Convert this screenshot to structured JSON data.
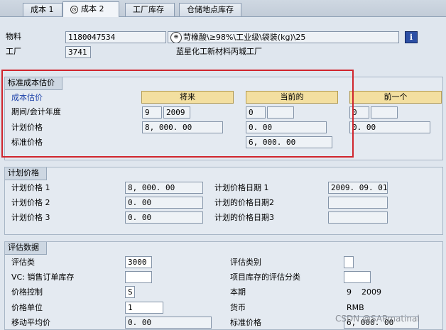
{
  "tabs": [
    {
      "label": "成本 1"
    },
    {
      "label": "成本 2",
      "icon": "display-icon"
    },
    {
      "label": "工厂库存"
    },
    {
      "label": "仓储地点库存"
    }
  ],
  "header": {
    "material_label": "物料",
    "material_value": "1180047534",
    "material_desc": "苛橡酸\\≥98%\\工业级\\袋装(kg)\\25",
    "material_icon_glyph": "⊕",
    "plant_label": "工厂",
    "plant_value": "3741",
    "plant_desc": "蓝星化工新材料丙城工厂",
    "info_glyph": "i"
  },
  "std_cost": {
    "title": "标准成本估价",
    "sub_label": "成本估价",
    "col_future": "将来",
    "col_current": "当前的",
    "col_previous": "前一个",
    "row_period_label": "期间/会计年度",
    "row_plan_label": "计划价格",
    "row_std_label": "标准价格",
    "future_period": "9",
    "future_year": "2009",
    "future_plan": "8, 000. 00",
    "current_period": "0",
    "current_year": "",
    "current_plan": "0. 00",
    "current_std": "6, 000. 00",
    "prev_period": "0",
    "prev_year": "",
    "prev_plan": "0. 00"
  },
  "planned": {
    "title": "计划价格",
    "p1_label": "计划价格 1",
    "p1_value": "8, 000. 00",
    "p2_label": "计划价格 2",
    "p2_value": "0. 00",
    "p3_label": "计划价格 3",
    "p3_value": "0. 00",
    "d1_label": "计划价格日期 1",
    "d1_value": "2009. 09. 01",
    "d2_label": "计划的价格日期2",
    "d2_value": "",
    "d3_label": "计划的价格日期3",
    "d3_value": ""
  },
  "valuation": {
    "title": "评估数据",
    "class_label": "评估类",
    "class_value": "3000",
    "vc_label": "VC: 销售订单库存",
    "vc_value": "",
    "price_ctrl_label": "价格控制",
    "price_ctrl_value": "S",
    "price_unit_label": "价格单位",
    "price_unit_value": "1",
    "mov_avg_label": "移动平均价",
    "mov_avg_value": "0. 00",
    "cat_label": "评估类别",
    "cat_value": "",
    "proj_label": "项目库存的评估分类",
    "proj_value": "",
    "period_label": "本期",
    "period_value": "9    2009",
    "currency_label": "货币",
    "currency_value": "RMB",
    "std_price_label": "标准价格",
    "std_price_value": "6, 000. 00"
  },
  "watermark": "CSDN @SAPmatinal",
  "colors": {
    "highlight": "#d0252d",
    "column_header": "#f3dfa0",
    "link_blue": "#1a3fa8"
  }
}
